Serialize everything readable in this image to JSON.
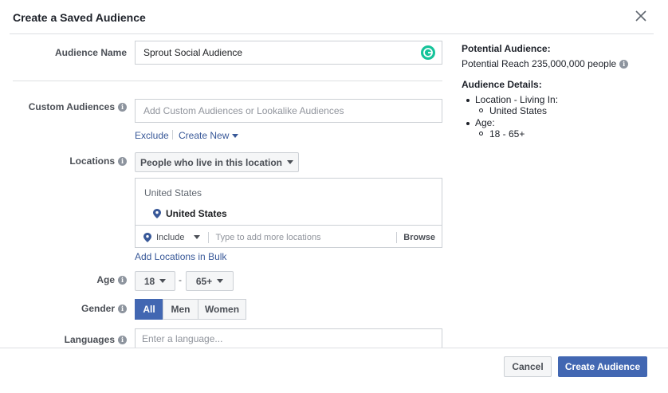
{
  "dialog": {
    "title": "Create a Saved Audience",
    "close_icon": "close-icon"
  },
  "form": {
    "audience_name": {
      "label": "Audience Name",
      "value": "Sprout Social Audience",
      "icon": "grammarly-icon"
    },
    "custom_audiences": {
      "label": "Custom Audiences",
      "placeholder": "Add Custom Audiences or Lookalike Audiences",
      "exclude_link": "Exclude",
      "create_new_link": "Create New"
    },
    "locations": {
      "label": "Locations",
      "dropdown_value": "People who live in this location",
      "country_header": "United States",
      "selected_location": "United States",
      "include_label": "Include",
      "search_placeholder": "Type to add more locations",
      "browse_label": "Browse",
      "bulk_link": "Add Locations in Bulk"
    },
    "age": {
      "label": "Age",
      "min": "18",
      "separator": "-",
      "max": "65+"
    },
    "gender": {
      "label": "Gender",
      "options": [
        "All",
        "Men",
        "Women"
      ],
      "selected": "All"
    },
    "languages": {
      "label": "Languages",
      "placeholder": "Enter a language..."
    }
  },
  "summary": {
    "potential_title": "Potential Audience:",
    "potential_reach": "Potential Reach 235,000,000 people",
    "details_title": "Audience Details:",
    "location_item": "Location - Living In:",
    "location_value": "United States",
    "age_item": "Age:",
    "age_value": "18 - 65+"
  },
  "footer": {
    "cancel_label": "Cancel",
    "create_label": "Create Audience"
  },
  "colors": {
    "primary": "#4267b2",
    "link": "#385898",
    "grammarly": "#15c39a"
  }
}
